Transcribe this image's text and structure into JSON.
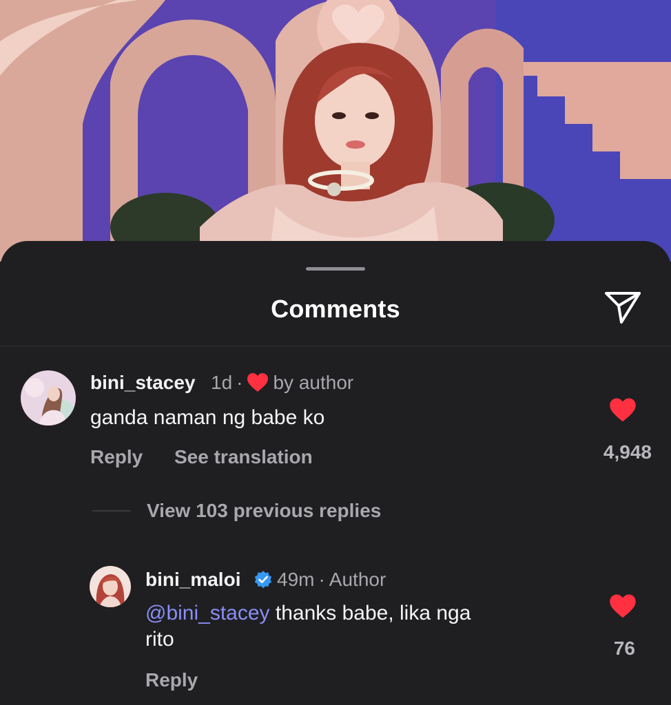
{
  "sheet": {
    "title": "Comments",
    "share_icon": "paper-plane-icon"
  },
  "comment": {
    "username": "bini_stacey",
    "time": "1d",
    "separator": "·",
    "liked_by_author_label": "by author",
    "text": "ganda naman ng babe ko",
    "reply_label": "Reply",
    "translate_label": "See translation",
    "like_count": "4,948",
    "like_icon": "heart-icon",
    "heart_color": "#ff3040"
  },
  "thread": {
    "view_replies_label": "View 103 previous replies"
  },
  "reply": {
    "username": "bini_maloi",
    "verified_icon": "verified-badge-icon",
    "time": "49m",
    "separator": "·",
    "author_label": "Author",
    "mention": "@bini_stacey",
    "text_line1": " thanks babe, lika nga",
    "text_line2": "rito",
    "reply_label": "Reply",
    "like_count": "76",
    "like_icon": "heart-icon"
  },
  "colors": {
    "background": "#1f1f22",
    "mention": "#8a8ef5",
    "verified": "#3897f0"
  }
}
